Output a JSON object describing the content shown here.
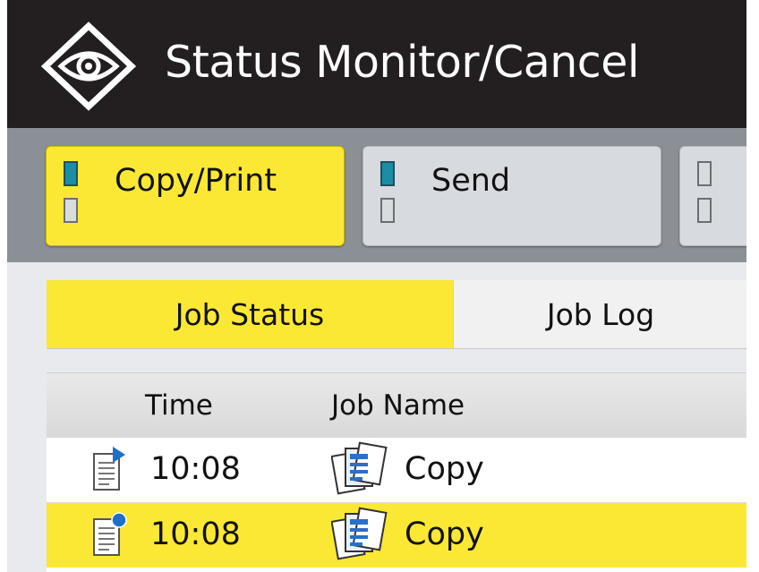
{
  "header": {
    "title": "Status Monitor/Cancel",
    "icon": "eye-icon"
  },
  "categories": [
    {
      "label": "Copy/Print",
      "active": true
    },
    {
      "label": "Send",
      "active": false
    },
    {
      "label": "",
      "active": false
    }
  ],
  "subtabs": {
    "job_status": "Job Status",
    "job_log": "Job Log"
  },
  "table": {
    "columns": {
      "time": "Time",
      "job_name": "Job Name"
    },
    "rows": [
      {
        "time": "10:08",
        "name": "Copy",
        "status_icon": "document-processing-icon",
        "job_icon": "copy-job-icon"
      },
      {
        "time": "10:08",
        "name": "Copy",
        "status_icon": "document-waiting-icon",
        "job_icon": "copy-job-icon"
      }
    ]
  },
  "colors": {
    "accent": "#fbe834",
    "indicator_on": "#1b8da6",
    "titlebar": "#231f20"
  }
}
